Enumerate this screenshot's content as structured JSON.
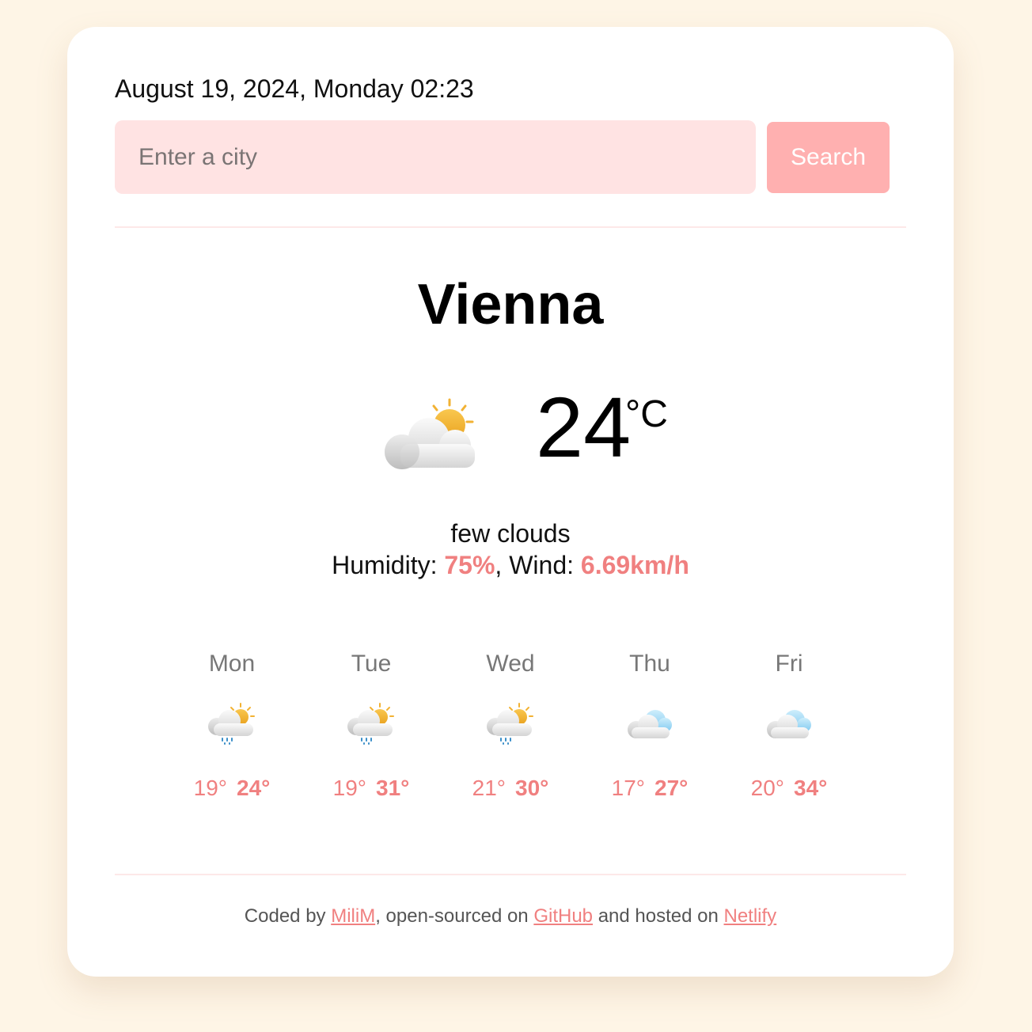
{
  "header": {
    "date": "August 19, 2024, Monday 02:23",
    "search_placeholder": "Enter a city",
    "search_button": "Search"
  },
  "current": {
    "city": "Vienna",
    "icon": "few-clouds-day-icon",
    "temperature": "24",
    "unit": "°C",
    "description": "few clouds",
    "humidity_label": "Humidity: ",
    "humidity": "75%",
    "wind_label": ", Wind: ",
    "wind": "6.69km/h"
  },
  "forecast": [
    {
      "day": "Mon",
      "icon": "rain-sun-icon",
      "min": "19°",
      "max": "24°"
    },
    {
      "day": "Tue",
      "icon": "rain-sun-icon",
      "min": "19°",
      "max": "31°"
    },
    {
      "day": "Wed",
      "icon": "rain-sun-icon",
      "min": "21°",
      "max": "30°"
    },
    {
      "day": "Thu",
      "icon": "cloudy-icon",
      "min": "17°",
      "max": "27°"
    },
    {
      "day": "Fri",
      "icon": "cloudy-icon",
      "min": "20°",
      "max": "34°"
    }
  ],
  "footer": {
    "prefix": "Coded by ",
    "author": "MiliM",
    "middle": ", open-sourced on ",
    "github": "GitHub",
    "middle2": " and hosted on ",
    "netlify": "Netlify"
  },
  "colors": {
    "background": "#fef5e6",
    "accent": "#f08080",
    "input_bg": "#ffe3e3",
    "button_bg": "#ffb0b0"
  }
}
